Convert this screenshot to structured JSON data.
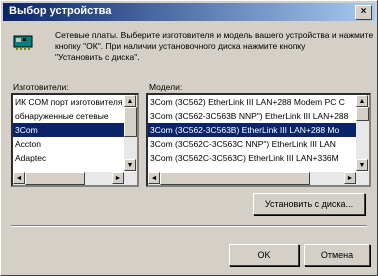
{
  "window": {
    "title": "Выбор устройства",
    "close_glyph": "×"
  },
  "info": {
    "icon": "network-card-icon",
    "lines": [
      "Сетевые платы. Выберите изготовителя и модель вашего устройства и нажмите",
      "кнопку \"ОК\". При наличии установочного диска нажмите кнопку",
      "\"Установить с диска\"."
    ]
  },
  "manufacturers": {
    "label": "Изготовители:",
    "items": [
      "ИК COM порт изготовителя",
      "обнаруженные сетевые",
      "3Com",
      "Accton",
      "Adaptec"
    ],
    "selected_index": 2
  },
  "models": {
    "label": "Модели:",
    "items": [
      "3Com (3C562) EtherLink III LAN+288 Modem PC C",
      "3Com (3C562-3C563B NNP\") EtherLink III LAN+288",
      "3Com (3C562-3C563B) EtherLink III LAN+288 Mo",
      "3Com (3C562C-3C563C NNP\") EtherLink III LAN",
      "3Com (3C562C-3C563C) EtherLink III LAN+336M"
    ],
    "selected_index": 2
  },
  "buttons": {
    "install_disk": "Установить с диска...",
    "ok": "OK",
    "cancel": "Отмена"
  }
}
